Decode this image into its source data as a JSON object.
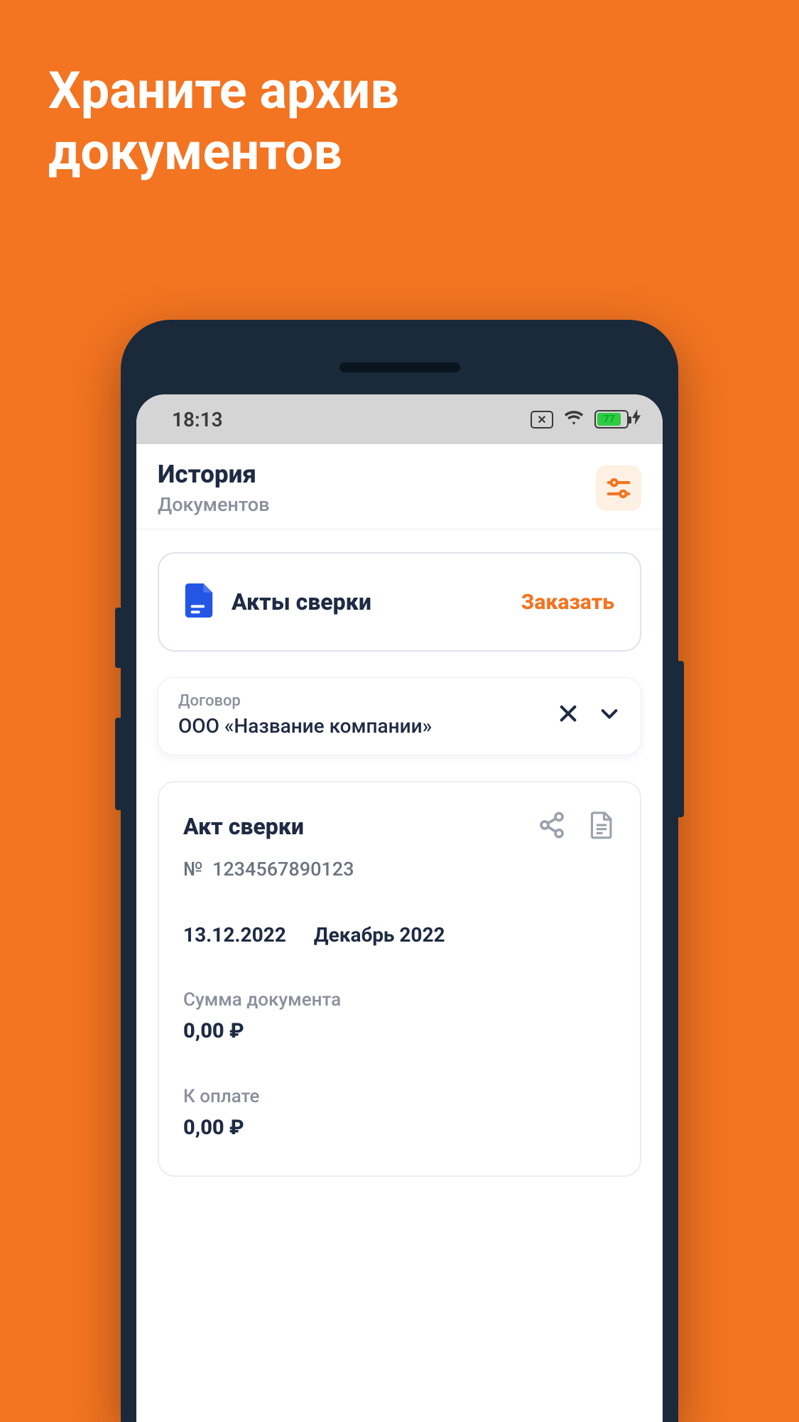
{
  "promo": {
    "title_line1": "Храните архив",
    "title_line2": "документов"
  },
  "status_bar": {
    "time": "18:13",
    "battery_percent": "77"
  },
  "header": {
    "title": "История",
    "subtitle": "Документов"
  },
  "verify_card": {
    "title": "Акты сверки",
    "order_label": "Заказать"
  },
  "contract": {
    "label": "Договор",
    "value": "ООО «Название компании»"
  },
  "document": {
    "title": "Акт сверки",
    "number_prefix": "№",
    "number_value": "1234567890123",
    "date": "13.12.2022",
    "period": "Декабрь 2022",
    "sum_label": "Сумма документа",
    "sum_value": "0,00 ₽",
    "due_label": "К оплате",
    "due_value": "0,00 ₽"
  },
  "colors": {
    "brand": "#f37421"
  }
}
